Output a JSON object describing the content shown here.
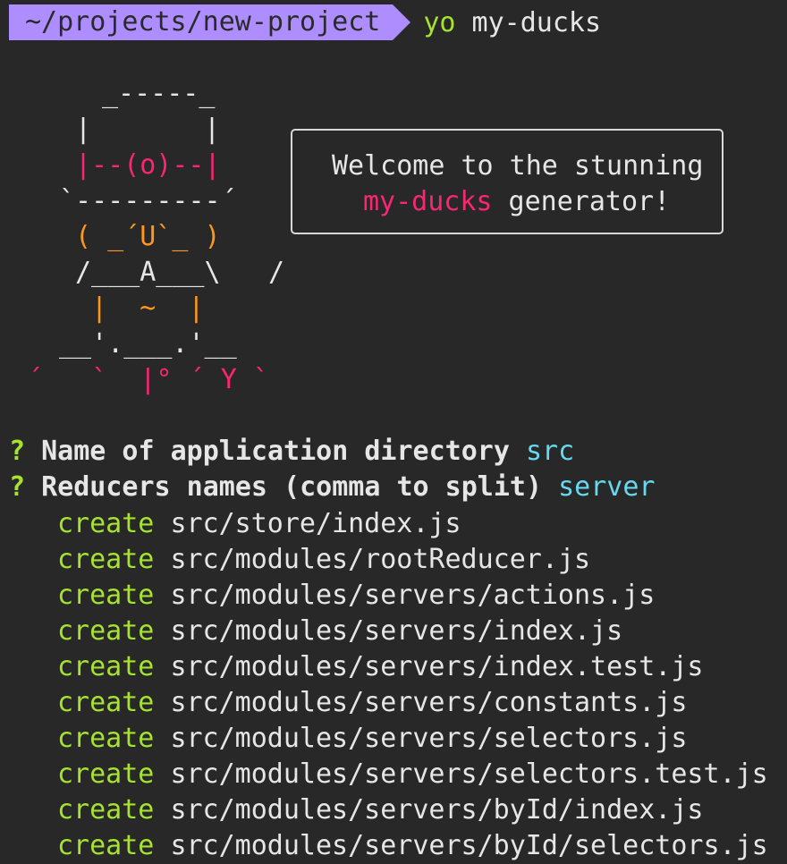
{
  "prompt": {
    "path": "~/projects/new-project",
    "command": "yo",
    "argument": "my-ducks"
  },
  "ascii_art": {
    "hat_top": "_-----_",
    "hat_side_left": "|",
    "hat_side_right": "|",
    "hat_band": "|--(o)--|",
    "brim": "`---------´",
    "face": "( _´U`_ )",
    "body": "/___A___\\",
    "arm": "/",
    "legs": "|  ~  |",
    "tail_top": "__'.___.'__",
    "tail_bottom": "´   `  |° ´ Y `"
  },
  "greeting": {
    "line1": "Welcome to the stunning",
    "highlight": "my-ducks",
    "line2_rest": " generator!"
  },
  "questions": [
    {
      "mark": "?",
      "text": "Name of application directory",
      "answer": "src"
    },
    {
      "mark": "?",
      "text": "Reducers names (comma to split)",
      "answer": "server"
    }
  ],
  "created_keyword": "create",
  "created_files": [
    "src/store/index.js",
    "src/modules/rootReducer.js",
    "src/modules/servers/actions.js",
    "src/modules/servers/index.js",
    "src/modules/servers/index.test.js",
    "src/modules/servers/constants.js",
    "src/modules/servers/selectors.js",
    "src/modules/servers/selectors.test.js",
    "src/modules/servers/byId/index.js",
    "src/modules/servers/byId/selectors.js"
  ],
  "colors": {
    "background": "#282828",
    "prompt_bg": "#ae8eff",
    "green": "#a6e22e",
    "pink": "#f92672",
    "orange": "#fd971f",
    "cyan": "#66d9ef",
    "text": "#e6e6e6"
  }
}
